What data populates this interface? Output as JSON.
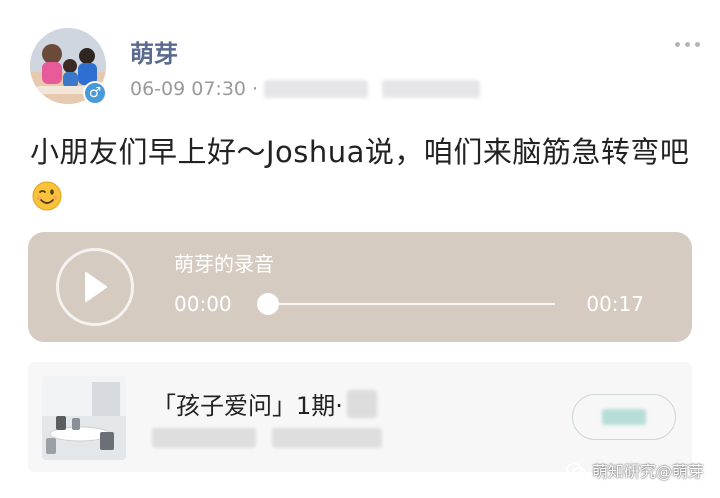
{
  "post": {
    "author": "萌芽",
    "timestamp": "06-09 07:30",
    "meta_separator": "·",
    "text": "小朋友们早上好～Joshua说，咱们来脑筋急转弯吧"
  },
  "icons": {
    "gender": "male-icon",
    "more": "more-dots-icon",
    "emoji": "wink-face-icon",
    "play": "play-icon"
  },
  "audio": {
    "title": "萌芽的录音",
    "current_time": "00:00",
    "duration": "00:17",
    "progress_fraction": 0.0
  },
  "link_card": {
    "title": "「孩子爱问」1期·"
  },
  "watermark": {
    "text": "萌知研究@萌芽"
  },
  "colors": {
    "author_name": "#5b6a8f",
    "audio_card_bg": "#d6cbc1",
    "gender_badge": "#4a9ad8",
    "link_card_bg": "#f7f7f7"
  }
}
